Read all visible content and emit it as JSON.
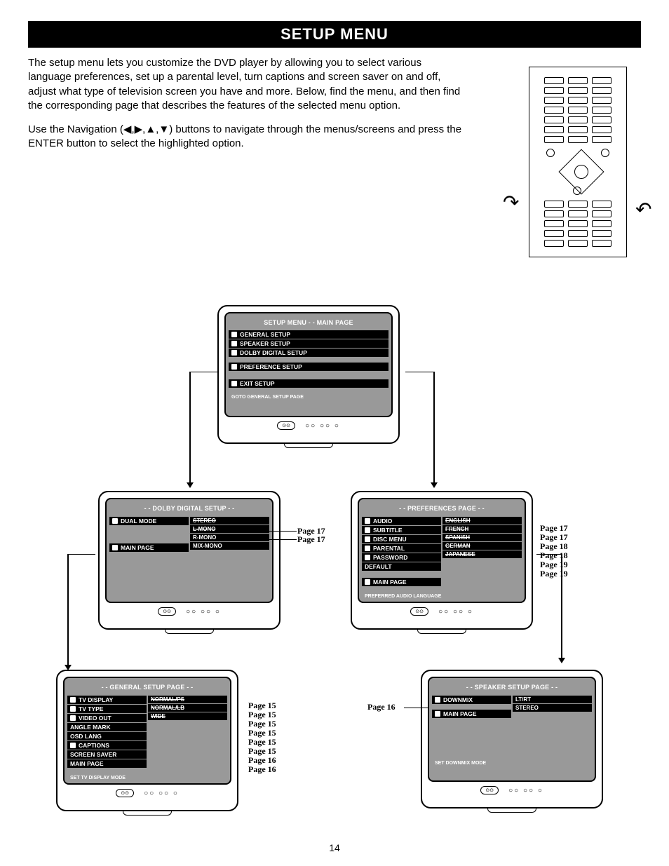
{
  "page_number": "14",
  "title": "SETUP MENU",
  "intro": {
    "p1": "The setup menu lets you customize the DVD player by allowing you to select various language preferences, set up a parental level, turn captions and screen saver on and off, adjust what type of television screen you have and more. Below, find the menu, and then find the corresponding page that describes the features of the selected menu option.",
    "p2_a": "Use the Navigation (",
    "p2_arrows": "◀,▶,▲,▼",
    "p2_b": ") buttons     to navigate through the menus/screens and press the ENTER button     to select the highlighted option."
  },
  "screens": {
    "main": {
      "title": "SETUP MENU  - - MAIN PAGE",
      "items": [
        "GENERAL  SETUP",
        "SPEAKER SETUP",
        "DOLBY DIGITAL SETUP",
        "PREFERENCE SETUP",
        "EXIT SETUP"
      ],
      "hint": "GOTO GENERAL SETUP PAGE"
    },
    "dolby": {
      "title": "- -  DOLBY DIGITAL SETUP  - -",
      "left": [
        "DUAL MODE",
        "MAIN PAGE"
      ],
      "right": [
        "STEREO",
        "L-MONO",
        "R-MONO",
        "MIX-MONO"
      ],
      "pages": [
        "Page 17",
        "Page 17"
      ]
    },
    "prefs": {
      "title": "- - PREFERENCES PAGE - -",
      "left": [
        "AUDIO",
        "SUBTITLE",
        "DISC MENU",
        "PARENTAL",
        "PASSWORD",
        "DEFAULT",
        "MAIN PAGE"
      ],
      "right": [
        "ENGLISH",
        "FRENCH",
        "SPANISH",
        "GERMAN",
        "JAPANESE"
      ],
      "hint": "PREFERRED AUDIO LANGUAGE",
      "pages": [
        "Page 17",
        "Page 17",
        "Page 18",
        "Page 18",
        "Page 19",
        "Page 19"
      ]
    },
    "general": {
      "title": "- - GENERAL SETUP PAGE - -",
      "left": [
        "TV DISPLAY",
        "TV TYPE",
        "VIDEO OUT",
        "ANGLE MARK",
        "OSD LANG",
        "CAPTIONS",
        "SCREEN SAVER",
        "MAIN PAGE"
      ],
      "right": [
        "NORMAL/PS",
        "NORMAL/LB",
        "WIDE"
      ],
      "hint": "SET TV DISPLAY MODE",
      "pages": [
        "Page 15",
        "Page 15",
        "Page 15",
        "Page 15",
        "Page 15",
        "Page 15",
        "Page 16",
        "Page 16"
      ]
    },
    "speaker": {
      "title": "- - SPEAKER SETUP PAGE - -",
      "left": [
        "DOWNMIX",
        "MAIN PAGE"
      ],
      "right": [
        "LT/RT",
        "STEREO"
      ],
      "hint": "SET DOWNMIX MODE",
      "pages": [
        "Page 16"
      ]
    }
  }
}
